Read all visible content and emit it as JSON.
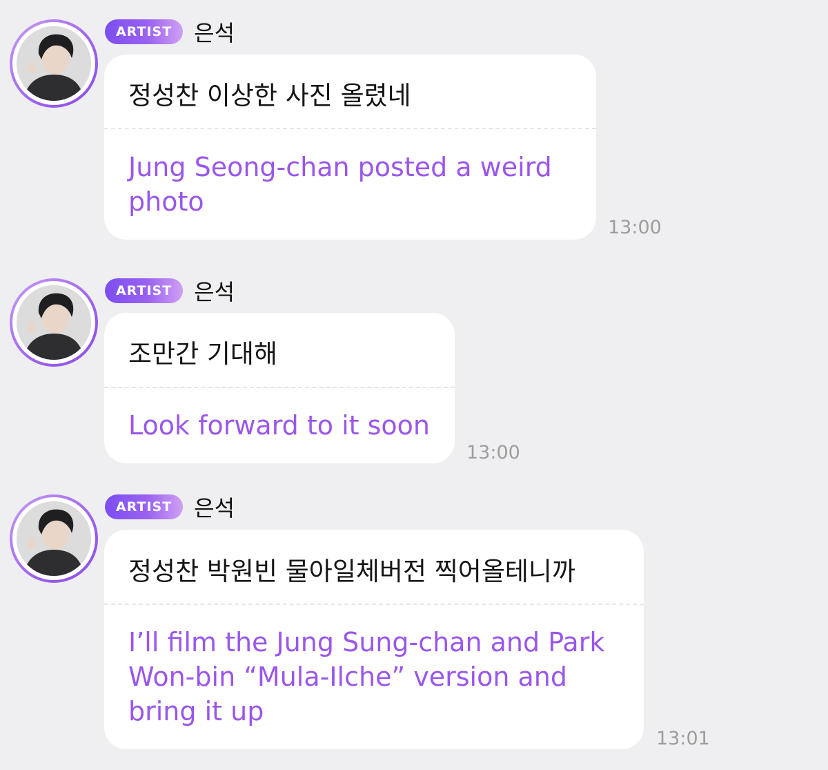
{
  "messages": [
    {
      "badge": "ARTIST",
      "sender": "은석",
      "original": "정성찬 이상한 사진 올렸네",
      "translation": "Jung Seong-chan posted a weird photo",
      "time": "13:00"
    },
    {
      "badge": "ARTIST",
      "sender": "은석",
      "original": "조만간 기대해",
      "translation": "Look forward to it soon",
      "time": "13:00"
    },
    {
      "badge": "ARTIST",
      "sender": "은석",
      "original": "정성찬 박원빈 물아일체버전 찍어올테니까",
      "translation": "I’ll film the Jung Sung-chan and Park Won-bin “Mula-Ilche” version and bring it up",
      "time": "13:01"
    }
  ],
  "colors": {
    "background": "#efeff1",
    "translation_text": "#9a57ea",
    "badge_gradient_start": "#7b4ef0",
    "badge_gradient_end": "#cfa0f5",
    "timestamp": "#9d9d9d"
  }
}
